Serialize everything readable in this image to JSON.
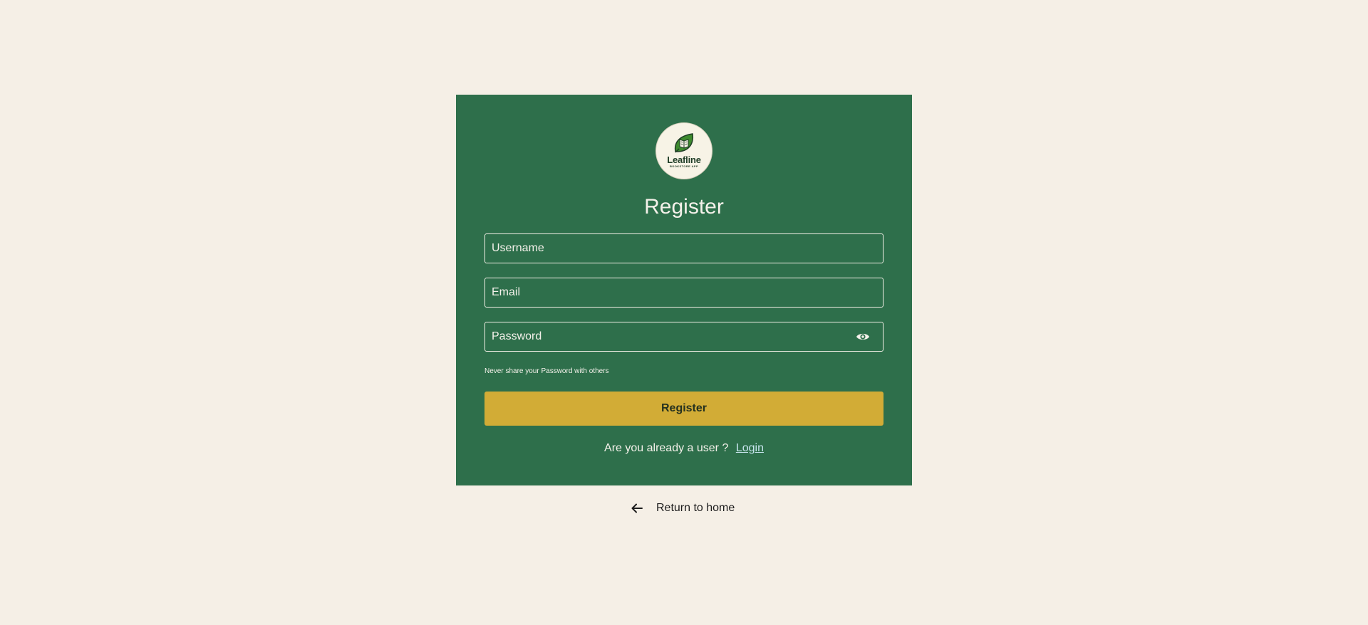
{
  "brand": {
    "name": "Leafline",
    "tagline": "BOOKSTORE APP"
  },
  "form": {
    "title": "Register",
    "username_placeholder": "Username",
    "email_placeholder": "Email",
    "password_placeholder": "Password",
    "password_hint": "Never share your Password with others",
    "submit_label": "Register",
    "login_prompt": "Are you already a user ?",
    "login_link": "Login"
  },
  "footer": {
    "return_label": "Return to home"
  },
  "colors": {
    "page_background": "#f5efe6",
    "card_background": "#2e6f4b",
    "button": "#d2ac36",
    "link": "#c9e6ef"
  },
  "icons": {
    "logo": "leaf-book-icon",
    "password_toggle": "eye-icon",
    "return": "arrow-left-icon"
  }
}
